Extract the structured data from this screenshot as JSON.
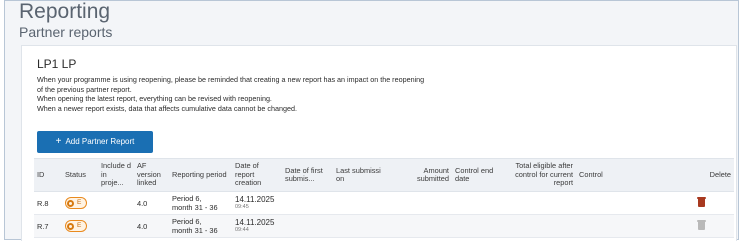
{
  "header": {
    "title": "Reporting",
    "subtitle": "Partner reports"
  },
  "card": {
    "title": "LP1 LP",
    "info_lines": [
      "When your programme is using reopening, please be reminded that creating a new report has an impact on the reopening",
      "of the previous partner report.",
      "When opening the latest report, everything can be revised with reopening.",
      "When a newer report exists, data that affects cumulative data cannot be changed."
    ],
    "add_button_label": "Add Partner Report",
    "add_button_icon": "+"
  },
  "table": {
    "headers": {
      "id": "ID",
      "status": "Status",
      "included": "Include d in proje...",
      "af_version": "AF version linked",
      "period": "Reporting period",
      "creation": "Date of report creation",
      "first_submission": "Date of first submis...",
      "last_submission": "Last submissi on",
      "amount": "Amount submitted",
      "control_end": "Control end date",
      "total_eligible": "Total eligible after control for current report",
      "control": "Control",
      "delete": "Delete"
    },
    "rows": [
      {
        "id": "R.8",
        "status_letter": "E",
        "status_icon": "draft-circle-icon",
        "included": "",
        "af_version": "4.0",
        "period_line1": "Period 6,",
        "period_line2": "month 31 - 36",
        "creation_date": "14.11.2025",
        "creation_time": "09:45",
        "first_submission": "",
        "last_submission": "",
        "amount": "",
        "control_end": "",
        "total_eligible": "",
        "control": "",
        "delete_enabled": true
      },
      {
        "id": "R.7",
        "status_letter": "E",
        "status_icon": "draft-circle-icon",
        "included": "",
        "af_version": "4.0",
        "period_line1": "Period 6,",
        "period_line2": "month 31 - 36",
        "creation_date": "14.11.2025",
        "creation_time": "09:44",
        "first_submission": "",
        "last_submission": "",
        "amount": "",
        "control_end": "",
        "total_eligible": "",
        "control": "",
        "delete_enabled": false
      }
    ]
  },
  "colors": {
    "accent": "#1a6fb3",
    "status_orange": "#e98a1e",
    "delete_active": "#a8391f",
    "delete_inactive": "#b9b9b9"
  }
}
